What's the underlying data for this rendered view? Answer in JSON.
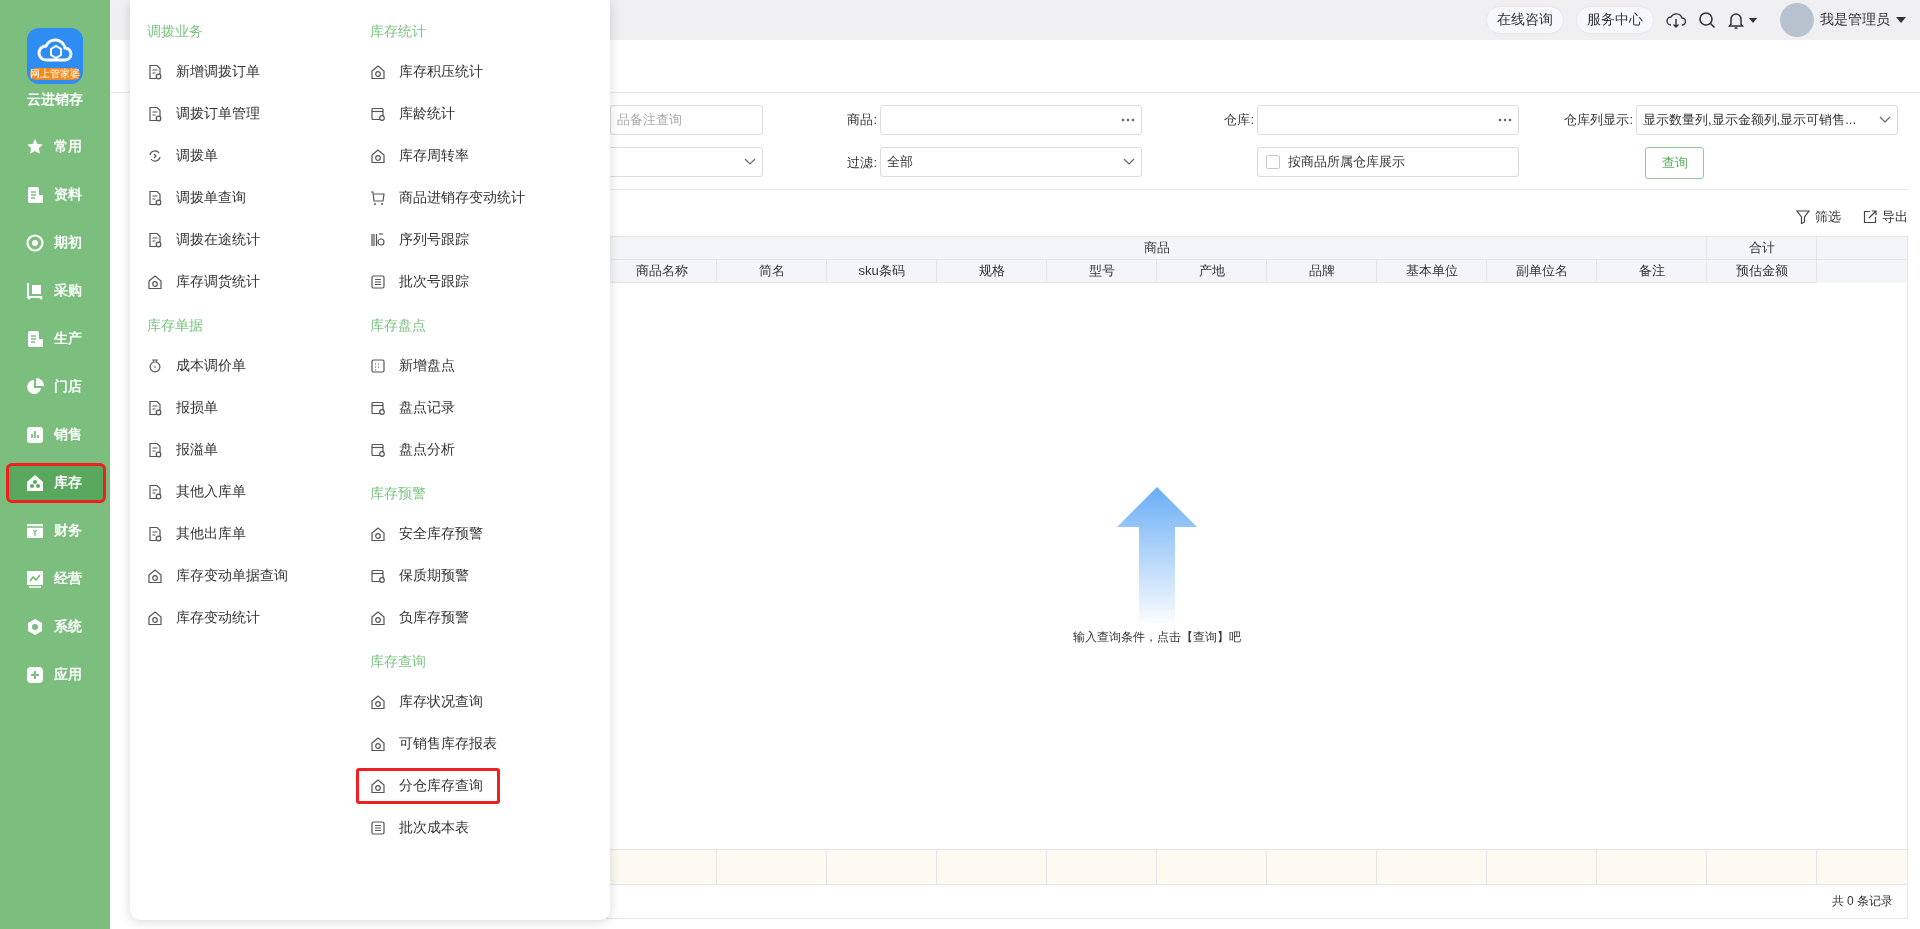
{
  "sidebar": {
    "logo_badge": "网上管家婆",
    "app_name": "云进销存",
    "items": [
      {
        "label": "常用",
        "selected": false,
        "highlighted": false
      },
      {
        "label": "资料",
        "selected": false,
        "highlighted": false
      },
      {
        "label": "期初",
        "selected": false,
        "highlighted": false
      },
      {
        "label": "采购",
        "selected": false,
        "highlighted": false
      },
      {
        "label": "生产",
        "selected": false,
        "highlighted": false
      },
      {
        "label": "门店",
        "selected": false,
        "highlighted": false
      },
      {
        "label": "销售",
        "selected": false,
        "highlighted": false
      },
      {
        "label": "库存",
        "selected": true,
        "highlighted": true
      },
      {
        "label": "财务",
        "selected": false,
        "highlighted": false
      },
      {
        "label": "经营",
        "selected": false,
        "highlighted": false
      },
      {
        "label": "系统",
        "selected": false,
        "highlighted": false
      },
      {
        "label": "应用",
        "selected": false,
        "highlighted": false
      }
    ]
  },
  "topbar": {
    "buttons": [
      "在线咨询",
      "服务中心"
    ],
    "user": "我是管理员"
  },
  "menu": {
    "columns": [
      [
        {
          "title": "调拨业务",
          "items": [
            {
              "label": "新增调拨订单",
              "highlighted": false
            },
            {
              "label": "调拨订单管理",
              "highlighted": false
            },
            {
              "label": "调拨单",
              "highlighted": false
            },
            {
              "label": "调拨单查询",
              "highlighted": false
            },
            {
              "label": "调拨在途统计",
              "highlighted": false
            },
            {
              "label": "库存调货统计",
              "highlighted": false
            }
          ]
        },
        {
          "title": "库存单据",
          "items": [
            {
              "label": "成本调价单",
              "highlighted": false
            },
            {
              "label": "报损单",
              "highlighted": false
            },
            {
              "label": "报溢单",
              "highlighted": false
            },
            {
              "label": "其他入库单",
              "highlighted": false
            },
            {
              "label": "其他出库单",
              "highlighted": false
            },
            {
              "label": "库存变动单据查询",
              "highlighted": false
            },
            {
              "label": "库存变动统计",
              "highlighted": false
            }
          ]
        }
      ],
      [
        {
          "title": "库存统计",
          "items": [
            {
              "label": "库存积压统计",
              "highlighted": false
            },
            {
              "label": "库龄统计",
              "highlighted": false
            },
            {
              "label": "库存周转率",
              "highlighted": false
            },
            {
              "label": "商品进销存变动统计",
              "highlighted": false
            },
            {
              "label": "序列号跟踪",
              "highlighted": false
            },
            {
              "label": "批次号跟踪",
              "highlighted": false
            }
          ]
        },
        {
          "title": "库存盘点",
          "items": [
            {
              "label": "新增盘点",
              "highlighted": false
            },
            {
              "label": "盘点记录",
              "highlighted": false
            },
            {
              "label": "盘点分析",
              "highlighted": false
            }
          ]
        },
        {
          "title": "库存预警",
          "items": [
            {
              "label": "安全库存预警",
              "highlighted": false
            },
            {
              "label": "保质期预警",
              "highlighted": false
            },
            {
              "label": "负库存预警",
              "highlighted": false
            }
          ]
        },
        {
          "title": "库存查询",
          "items": [
            {
              "label": "库存状况查询",
              "highlighted": false
            },
            {
              "label": "可销售库存报表",
              "highlighted": false
            },
            {
              "label": "分仓库存查询",
              "highlighted": true
            },
            {
              "label": "批次成本表",
              "highlighted": false
            }
          ]
        }
      ]
    ]
  },
  "filters": {
    "note": {
      "placeholder": "品备注查询"
    },
    "product": {
      "label": "商品:"
    },
    "warehouse": {
      "label": "仓库:"
    },
    "columns_display": {
      "label": "仓库列显示:",
      "value": "显示数量列,显示金额列,显示可销售..."
    },
    "filter": {
      "label": "过滤:",
      "value": "全部"
    },
    "by_warehouse": {
      "label": "按商品所属仓库展示",
      "checked": false
    },
    "query_button": "查询"
  },
  "toolbar": [
    "筛选",
    "导出"
  ],
  "table": {
    "groups": [
      "商品",
      "合计"
    ],
    "columns": [
      "商品名称",
      "简名",
      "sku条码",
      "规格",
      "型号",
      "产地",
      "品牌",
      "基本单位",
      "副单位名",
      "备注",
      "预估金额"
    ],
    "empty_text": "输入查询条件，点击【查询】吧",
    "record_count": "共 0 条记录"
  }
}
